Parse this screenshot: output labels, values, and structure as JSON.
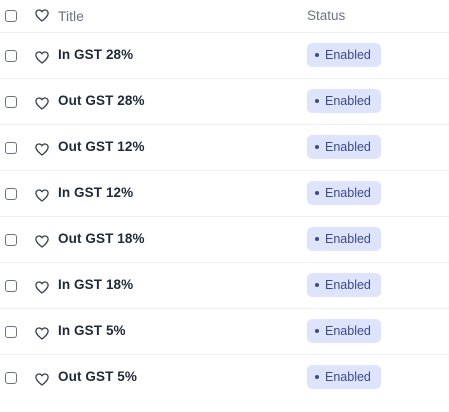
{
  "header": {
    "title_label": "Title",
    "status_label": "Status",
    "checkbox_icon": "checkbox-icon",
    "heart_icon": "heart-icon"
  },
  "rows": [
    {
      "title": "In GST 28%",
      "status": "Enabled"
    },
    {
      "title": "Out GST 28%",
      "status": "Enabled"
    },
    {
      "title": "Out GST 12%",
      "status": "Enabled"
    },
    {
      "title": "In GST 12%",
      "status": "Enabled"
    },
    {
      "title": "Out GST 18%",
      "status": "Enabled"
    },
    {
      "title": "In GST 18%",
      "status": "Enabled"
    },
    {
      "title": "In GST 5%",
      "status": "Enabled"
    },
    {
      "title": "Out GST 5%",
      "status": "Enabled"
    }
  ],
  "colors": {
    "badge_bg": "#dde4fb",
    "badge_text": "#3d4a8f",
    "divider": "#eceef1",
    "header_text": "#6b7280"
  }
}
